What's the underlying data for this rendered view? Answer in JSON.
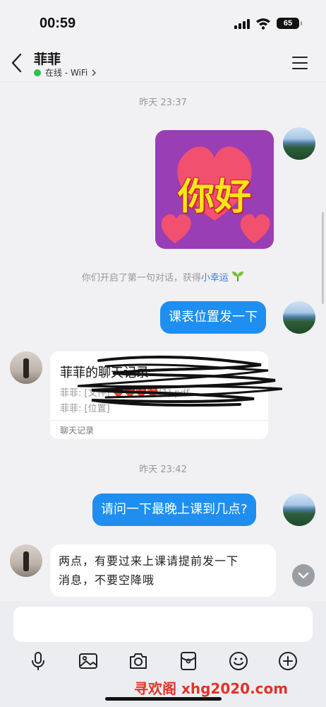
{
  "status_bar": {
    "time": "00:59",
    "battery": "65"
  },
  "header": {
    "contact_name": "菲菲",
    "presence": "在线 - WiFi"
  },
  "messages": {
    "timestamp_1": "昨天 23:37",
    "sticker_text": "你好",
    "system_notice_prefix": "你们开启了第一句对话，获得",
    "system_notice_link": "小幸运",
    "msg_out_1": "课表位置发一下",
    "forward_card": {
      "title": "菲菲的聊天记录",
      "line_1": "菲菲: [文件] ❤️❤️❤️❤️(1).pdf",
      "line_2": "菲菲: [位置]",
      "footer": "聊天记录"
    },
    "timestamp_2": "昨天 23:42",
    "msg_out_2": "请问一下最晚上课到几点?",
    "msg_in_2_line_1": "两点，有要过来上课请提前发一下",
    "msg_in_2_line_2": "消息，不要空降哦"
  },
  "composer": {
    "input_value": "",
    "input_placeholder": ""
  },
  "watermark": "寻欢阁 xhg2020.com",
  "colors": {
    "self_bubble": "#1e8ff1",
    "online": "#2bc34b",
    "link": "#3b7cd4"
  }
}
